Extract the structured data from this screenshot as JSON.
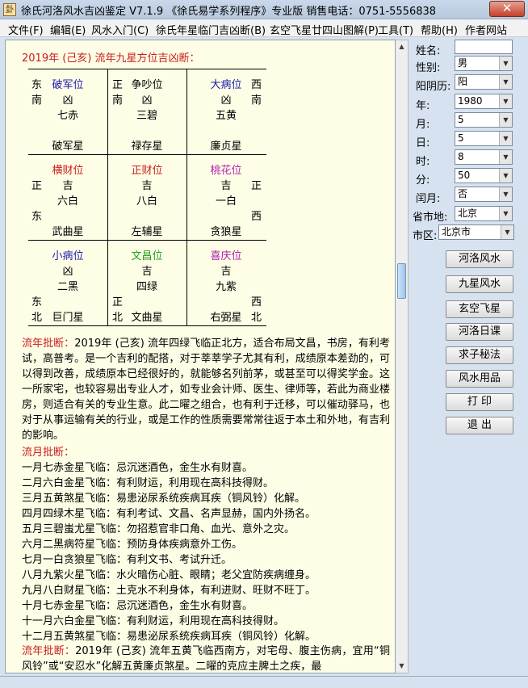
{
  "window": {
    "title": "徐氏河洛风水吉凶鉴定 V7.1.9  《徐氏易学系列程序》专业版   销售电话：0751-5556838",
    "close_glyph": "✕"
  },
  "menu": [
    "文件(F)",
    "编辑(E)",
    "风水入门(C)",
    "徐氏年星临门吉凶断(B)",
    "玄空飞星廿四山图解(P)",
    "工具(T)",
    "帮助(H)",
    "作者网站"
  ],
  "content": {
    "header": "2019年 (己亥) 流年九星方位吉凶断：",
    "grid": [
      {
        "dir_top_left": "东",
        "dir_bottom_left": "南",
        "dir_top_right": "",
        "dir_bottom_right": "",
        "position": "破军位",
        "position_color": "#1a1ab0",
        "luck": "凶",
        "number": "七赤",
        "star": "破军星"
      },
      {
        "dir_top_left": "正",
        "dir_bottom_left": "南",
        "dir_top_right": "",
        "dir_bottom_right": "",
        "position": "争吵位",
        "position_color": "#000000",
        "luck": "凶",
        "number": "三碧",
        "star": "禄存星"
      },
      {
        "dir_top_left": "",
        "dir_bottom_left": "",
        "dir_top_right": "西",
        "dir_bottom_right": "南",
        "position": "大病位",
        "position_color": "#1a1ab0",
        "luck": "凶",
        "number": "五黄",
        "star": "廉贞星"
      },
      {
        "dir_top_left": "正",
        "dir_bottom_left": "东",
        "dir_top_right": "",
        "dir_bottom_right": "",
        "position": "横财位",
        "position_color": "#c81e1e",
        "luck": "吉",
        "number": "六白",
        "star": "武曲星"
      },
      {
        "dir_top_left": "",
        "dir_bottom_left": "",
        "dir_top_right": "",
        "dir_bottom_right": "",
        "position": "正财位",
        "position_color": "#c81e1e",
        "luck": "吉",
        "number": "八白",
        "star": "左辅星"
      },
      {
        "dir_top_left": "",
        "dir_bottom_left": "",
        "dir_top_right": "正",
        "dir_bottom_right": "西",
        "position": "桃花位",
        "position_color": "#b01eb0",
        "luck": "吉",
        "number": "一白",
        "star": "贪狼星"
      },
      {
        "dir_top_left": "",
        "dir_bottom_left": "东",
        "dir_bottom_left2": "北",
        "dir_top_right": "",
        "dir_bottom_right": "",
        "position": "小病位",
        "position_color": "#1a1ab0",
        "luck": "凶",
        "number": "二黑",
        "star": "巨门星"
      },
      {
        "dir_top_left": "",
        "dir_bottom_left": "正",
        "dir_bottom_left2": "北",
        "dir_top_right": "",
        "dir_bottom_right": "",
        "position": "文昌位",
        "position_color": "#1ea01e",
        "luck": "吉",
        "number": "四绿",
        "star": "文曲星"
      },
      {
        "dir_top_left": "",
        "dir_bottom_left": "",
        "dir_top_right": "",
        "dir_bottom_right": "西",
        "dir_bottom_right2": "北",
        "position": "喜庆位",
        "position_color": "#b01eb0",
        "luck": "吉",
        "number": "九紫",
        "star": "右弼星"
      }
    ],
    "annual_label": "流年批断：",
    "annual_text": "2019年 (己亥) 流年四绿飞临正北方，适合布局文昌，书房，有利考试，高普考。是一个吉利的配搭，对于莘莘学子尤其有利，成绩原本差劲的，可以得到改善，成绩原本已经很好的，就能够名列前茅，或甚至可以得奖学金。这一所家宅，也较容易出专业人才，如专业会计师、医生、律师等，若此为商业楼房，则适合有关的专业生意。此二曜之组合，也有利于迁移，可以催动驿马，也对于从事运输有关的行业，或是工作的性质需要常常往返于本土和外地，有吉利的影响。",
    "monthly_label": "流月批断：",
    "monthly": [
      "一月七赤金星飞临：忌沉迷酒色，金生水有财喜。",
      "二月六白金星飞临：有利财运，利用现在高科技得财。",
      "三月五黄煞星飞临：易患泌尿系统疾病耳疾（铜风铃）化解。",
      "四月四绿木星飞临：有利考试、文昌、名声显赫，国内外扬名。",
      "五月三碧蚩尤星飞临：勿招惹官非口角、血光、意外之灾。",
      "六月二黑病符星飞临：预防身体疾病意外工伤。",
      "七月一白贪狼星飞临：有利文书、考试升迁。",
      "八月九紫火星飞临：水火暗伤心脏、眼睛；老父宜防疾病缠身。",
      "九月八白财星飞临：土克水不利身体，有利进财、旺财不旺丁。",
      "十月七赤金星飞临：忌沉迷酒色，金生水有财喜。",
      "十一月六白金星飞临：有利财运，利用现在高科技得财。",
      "十二月五黄煞星飞临：易患泌尿系统疾病耳疾（铜风铃）化解。"
    ],
    "annual2_label": "流年批断：",
    "annual2_text": "2019年 (己亥) 流年五黄飞临西南方，对宅母、腹主伤病，宜用“铜风铃”或“安忍水”化解五黄廉贞煞星。二曜的克应主脾土之疾，最"
  },
  "sidebar": {
    "name_label": "姓名:",
    "name_value": "",
    "gender_label": "性别:",
    "gender_value": "男",
    "calendar_label": "阳阴历:",
    "calendar_value": "阳",
    "year_label": "年:",
    "year_value": "1980",
    "month_label": "月:",
    "month_value": "5",
    "day_label": "日:",
    "day_value": "5",
    "hour_label": "时:",
    "hour_value": "8",
    "minute_label": "分:",
    "minute_value": "50",
    "leap_label": "闰月:",
    "leap_value": "否",
    "province_label": "省市地:",
    "province_value": "北京",
    "district_label": "市区:",
    "district_value": "北京市",
    "buttons": [
      "河洛风水",
      "九星风水",
      "玄空飞星",
      "河洛日课",
      "求子秘法",
      "风水用品",
      "打 印",
      "退 出"
    ]
  }
}
